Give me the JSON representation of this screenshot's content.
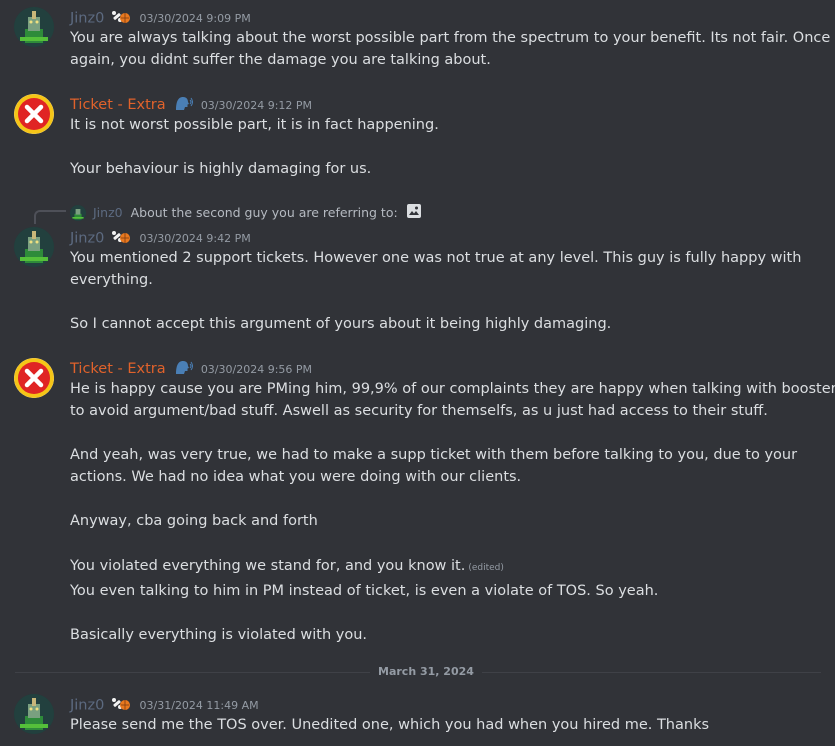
{
  "messages": [
    {
      "author": "Jinz0",
      "timestamp": "03/30/2024 9:09 PM",
      "lines": [
        "You are always talking about the worst possible part from the spectrum to your benefit. Its not fair. Once",
        "again, you didnt suffer the damage you are talking about."
      ]
    },
    {
      "author": "Ticket - Extra",
      "timestamp": "03/30/2024 9:12 PM",
      "lines": [
        "It is not worst possible part, it is in fact happening.",
        "Your behaviour is highly damaging for us."
      ]
    },
    {
      "reply": {
        "author": "Jinz0",
        "text": "About the second guy you are referring to:",
        "icon": "image-icon"
      },
      "author": "Jinz0",
      "timestamp": "03/30/2024 9:42 PM",
      "lines": [
        "You mentioned 2 support tickets. However one was not true at any level. This guy is fully happy with",
        "everything.",
        "So I cannot accept this argument of yours about it being highly damaging."
      ]
    },
    {
      "author": "Ticket - Extra",
      "timestamp": "03/30/2024 9:56 PM",
      "lines": [
        "He is happy cause you are PMing him, 99,9% of our complaints they are happy when talking with boosters,",
        "to avoid argument/bad stuff. Aswell as security for themselfs, as u just had access to their stuff.",
        "And yeah, was very true, we had to make a supp ticket with them before talking to you, due to your",
        "actions. We had no idea what you were doing with our clients.",
        "Anyway, cba going back and forth",
        "You violated everything we stand for, and you know it.",
        "You even talking to him in PM instead of ticket, is even a violate of TOS. So yeah.",
        "Basically everything is violated with you."
      ],
      "edited_label": "(edited)"
    },
    {
      "author": "Jinz0",
      "timestamp": "03/31/2024 11:49 AM",
      "lines": [
        "Please send me the TOS over. Unedited one, which you had when you hired me. Thanks"
      ]
    }
  ],
  "date_divider": "March 31, 2024",
  "colors": {
    "background": "#313338",
    "text": "#dbdee1",
    "muted": "#949ba4",
    "jinz_name": "#5c6a80",
    "ticket_name": "#e0622b",
    "avatar_red": "#e02424",
    "avatar_yellow": "#f5c518"
  },
  "icons": {
    "jinz_badge": "bone-and-ball-icon",
    "ticket_badge": "speaking-head-icon",
    "ticket_avatar": "red-x-icon"
  }
}
